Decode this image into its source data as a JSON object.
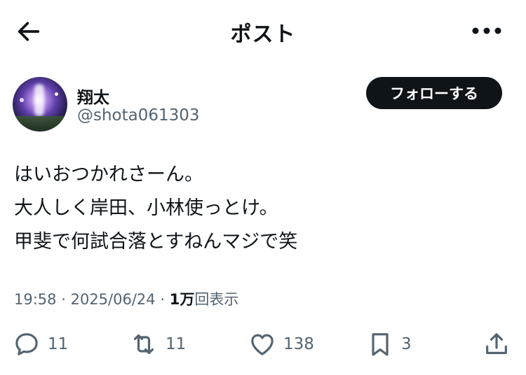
{
  "header": {
    "title": "ポスト"
  },
  "author": {
    "display_name": "翔太",
    "handle": "@shota061303",
    "follow_label": "フォローする"
  },
  "post": {
    "lines": [
      "はいおつかれさーん。",
      "大人しく岸田、小林使っとけ。",
      "甲斐で何試合落とすねんマジで笑"
    ],
    "time": "19:58",
    "date": "2025/06/24",
    "separator": "·",
    "views_count": "1万",
    "views_label": "回表示"
  },
  "actions": {
    "replies": "11",
    "reposts": "11",
    "likes": "138",
    "bookmarks": "3"
  },
  "icons": {
    "back": "arrow-left-icon",
    "more": "more-horizontal-icon",
    "reply": "reply-icon",
    "repost": "repost-icon",
    "like": "heart-icon",
    "bookmark": "bookmark-icon",
    "share": "share-icon"
  },
  "colors": {
    "text": "#0f1419",
    "secondary": "#536471",
    "follow_bg": "#0f1419"
  }
}
